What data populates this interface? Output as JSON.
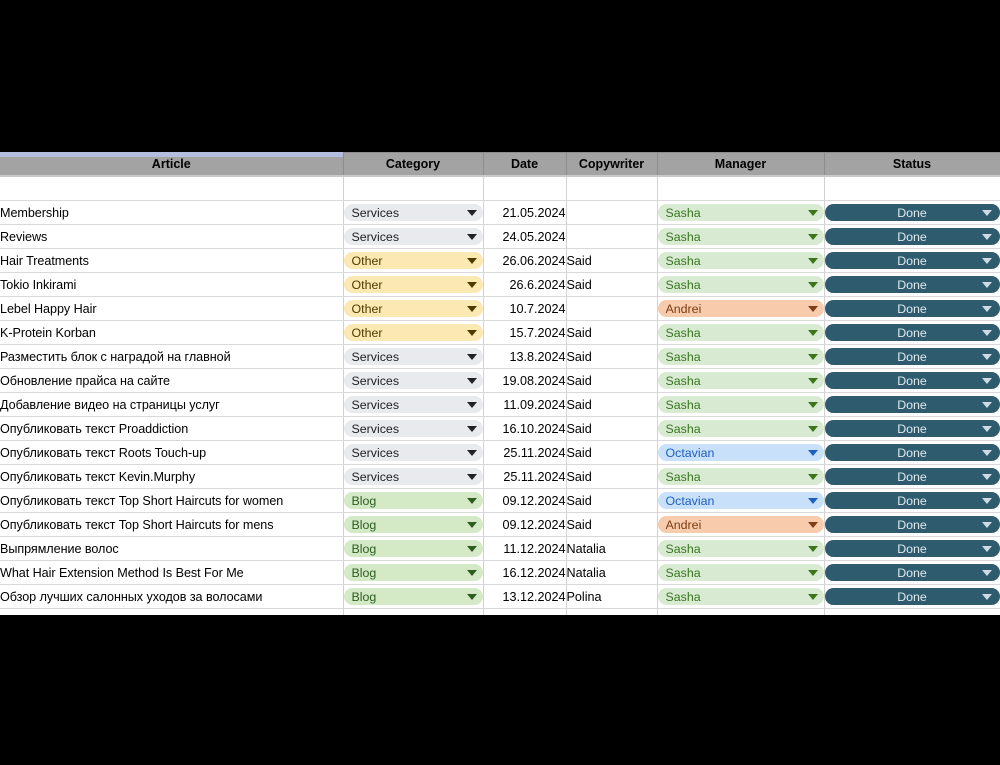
{
  "sheet": {
    "columns": [
      {
        "key": "article",
        "label": "Article"
      },
      {
        "key": "category",
        "label": "Category"
      },
      {
        "key": "date",
        "label": "Date"
      },
      {
        "key": "copywriter",
        "label": "Copywriter"
      },
      {
        "key": "manager",
        "label": "Manager"
      },
      {
        "key": "status",
        "label": "Status"
      }
    ],
    "colors": {
      "header_bg": "#a3a3a3",
      "grid_line": "#d9d9d9",
      "chip_services_bg": "#e8eaed",
      "chip_other_bg": "#fce8b2",
      "chip_blog_bg": "#d4e9c6",
      "chip_sasha_bg": "#d9ead3",
      "chip_andrei_bg": "#f9cbad",
      "chip_octavian_bg": "#c9e0fb",
      "chip_done_bg": "#2e5c6e",
      "chip_done_text": "#dfe8ec",
      "selection_strip": "#b4bede"
    },
    "icons": {
      "dropdown": "chevron-down-icon"
    },
    "rows": [
      {
        "article": "Membership",
        "category": "Services",
        "date": "21.05.2024",
        "copywriter": "",
        "manager": "Sasha",
        "status": "Done"
      },
      {
        "article": "Reviews",
        "category": "Services",
        "date": "24.05.2024",
        "copywriter": "",
        "manager": "Sasha",
        "status": "Done"
      },
      {
        "article": "Hair Treatments",
        "category": "Other",
        "date": "26.06.2024",
        "copywriter": "Said",
        "manager": "Sasha",
        "status": "Done"
      },
      {
        "article": "Tokio Inkirami",
        "category": "Other",
        "date": "26.6.2024",
        "copywriter": "Said",
        "manager": "Sasha",
        "status": "Done"
      },
      {
        "article": "Lebel Happy Hair",
        "category": "Other",
        "date": "10.7.2024",
        "copywriter": "",
        "manager": "Andrei",
        "status": "Done"
      },
      {
        "article": "K-Protein Korban",
        "category": "Other",
        "date": "15.7.2024",
        "copywriter": "Said",
        "manager": "Sasha",
        "status": "Done"
      },
      {
        "article": "Разместить блок с наградой на главной",
        "category": "Services",
        "date": "13.8.2024",
        "copywriter": "Said",
        "manager": "Sasha",
        "status": "Done"
      },
      {
        "article": "Обновление прайса на сайте",
        "category": "Services",
        "date": "19.08.2024",
        "copywriter": "Said",
        "manager": "Sasha",
        "status": "Done"
      },
      {
        "article": "Добавление видео на страницы услуг",
        "category": "Services",
        "date": "11.09.2024",
        "copywriter": "Said",
        "manager": "Sasha",
        "status": "Done"
      },
      {
        "article": "Опубликовать текст Proaddiction",
        "category": "Services",
        "date": "16.10.2024",
        "copywriter": "Said",
        "manager": "Sasha",
        "status": "Done"
      },
      {
        "article": "Опубликовать текст Roots Touch-up",
        "category": "Services",
        "date": "25.11.2024",
        "copywriter": "Said",
        "manager": "Octavian",
        "status": "Done"
      },
      {
        "article": "Опубликовать текст Kevin.Murphy",
        "category": "Services",
        "date": "25.11.2024",
        "copywriter": "Said",
        "manager": "Sasha",
        "status": "Done"
      },
      {
        "article": "Опубликовать текст Top Short Haircuts for women",
        "category": "Blog",
        "date": "09.12.2024",
        "copywriter": "Said",
        "manager": "Octavian",
        "status": "Done"
      },
      {
        "article": "Опубликовать текст Top Short Haircuts for mens",
        "category": "Blog",
        "date": "09.12.2024",
        "copywriter": "Said",
        "manager": "Andrei",
        "status": "Done"
      },
      {
        "article": "Выпрямление волос",
        "category": "Blog",
        "date": "11.12.2024",
        "copywriter": "Natalia",
        "manager": "Sasha",
        "status": "Done"
      },
      {
        "article": "What Hair Extension Method Is Best For Me",
        "category": "Blog",
        "date": "16.12.2024",
        "copywriter": "Natalia",
        "manager": "Sasha",
        "status": "Done"
      },
      {
        "article": "Обзор лучших салонных уходов за волосами",
        "category": "Blog",
        "date": "13.12.2024",
        "copywriter": "Polina",
        "manager": "Sasha",
        "status": "Done"
      }
    ]
  }
}
